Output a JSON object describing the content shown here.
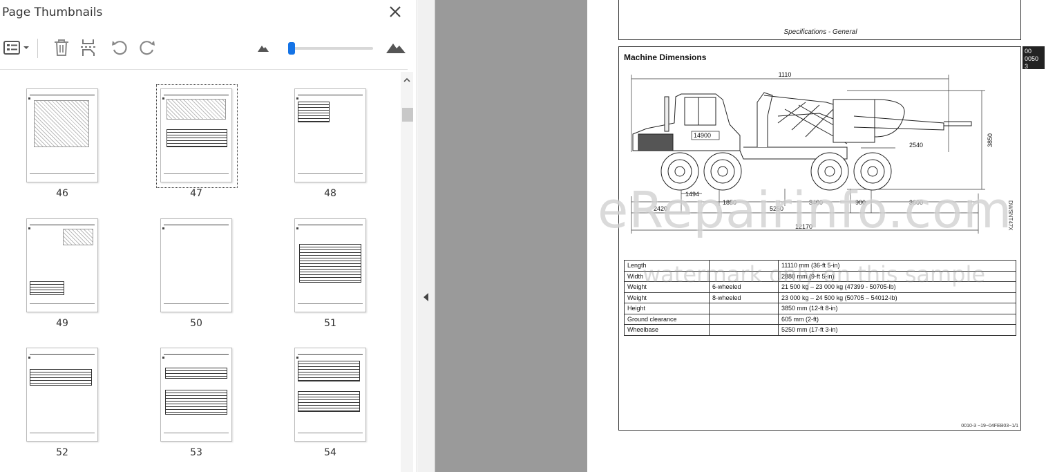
{
  "panel": {
    "title": "Page Thumbnails",
    "toolbar": {
      "options_icon": "list-options-icon",
      "delete_icon": "trash-icon",
      "extract_icon": "extract-pages-icon",
      "rotate_ccw_icon": "rotate-ccw-icon",
      "rotate_cw_icon": "rotate-cw-icon",
      "zoom_small_icon": "mountain-small-icon",
      "zoom_large_icon": "mountain-large-icon",
      "zoom_slider_fraction": 0.02
    },
    "thumbnails": [
      {
        "page": "46"
      },
      {
        "page": "47",
        "selected": true
      },
      {
        "page": "48"
      },
      {
        "page": "49"
      },
      {
        "page": "50"
      },
      {
        "page": "51"
      },
      {
        "page": "52"
      },
      {
        "page": "53"
      },
      {
        "page": "54"
      }
    ]
  },
  "document": {
    "header_title": "Specifications - General",
    "section_title": "Machine Dimensions",
    "side_tab": [
      "00",
      "0050",
      "3"
    ],
    "dimensions": {
      "top": "1110",
      "height": "3850",
      "cab": "14900",
      "boom": "2540",
      "d1494": "1494",
      "d1850": "1850",
      "d3400": "3400",
      "d900": "900",
      "d3600": "3600",
      "d2420": "2420",
      "d5250": "5250",
      "d12170": "12170"
    },
    "specs": [
      {
        "name": "Length",
        "variant": "",
        "value": "11110 mm (36-ft 5-in)"
      },
      {
        "name": "Width",
        "variant": "",
        "value": "2880 mm (9-ft 5-in)"
      },
      {
        "name": "Weight",
        "variant": "6-wheeled",
        "value": "21 500 kg – 23 000 kg (47399 - 50705-lb)"
      },
      {
        "name": "Weight",
        "variant": "8-wheeled",
        "value": "23 000 kg – 24 500 kg (50705 – 54012-lb)"
      },
      {
        "name": "Height",
        "variant": "",
        "value": "3850 mm (12-ft 8-in)"
      },
      {
        "name": "Ground clearance",
        "variant": "",
        "value": "605 mm (2-ft)"
      },
      {
        "name": "Wheelbase",
        "variant": "",
        "value": "5250 mm (17-ft 3-in)"
      }
    ],
    "footer_code": "0010-3   −19−04FEB03−1/1",
    "side_code": "DWSNT47X"
  },
  "watermark": {
    "main": "eRepairinfo.com",
    "sub": "watermark only on this sample"
  },
  "colors": {
    "accent": "#1473e6",
    "gutter": "#9a9a9a"
  }
}
